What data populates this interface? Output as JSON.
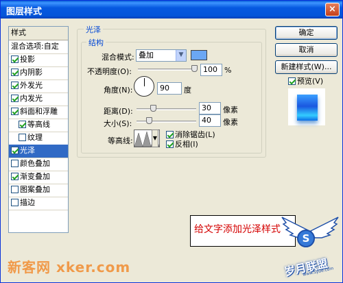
{
  "window": {
    "title": "图层样式",
    "close_glyph": "×"
  },
  "style_list": {
    "header": "样式",
    "items": [
      {
        "label": "混合选项:自定",
        "checkbox": false,
        "checked": false,
        "sub": false,
        "selected": false
      },
      {
        "label": "投影",
        "checkbox": true,
        "checked": true,
        "sub": false,
        "selected": false
      },
      {
        "label": "内阴影",
        "checkbox": true,
        "checked": true,
        "sub": false,
        "selected": false
      },
      {
        "label": "外发光",
        "checkbox": true,
        "checked": true,
        "sub": false,
        "selected": false
      },
      {
        "label": "内发光",
        "checkbox": true,
        "checked": true,
        "sub": false,
        "selected": false
      },
      {
        "label": "斜面和浮雕",
        "checkbox": true,
        "checked": true,
        "sub": false,
        "selected": false
      },
      {
        "label": "等高线",
        "checkbox": true,
        "checked": true,
        "sub": true,
        "selected": false
      },
      {
        "label": "纹理",
        "checkbox": true,
        "checked": false,
        "sub": true,
        "selected": false
      },
      {
        "label": "光泽",
        "checkbox": true,
        "checked": true,
        "sub": false,
        "selected": true
      },
      {
        "label": "颜色叠加",
        "checkbox": true,
        "checked": false,
        "sub": false,
        "selected": false
      },
      {
        "label": "渐变叠加",
        "checkbox": true,
        "checked": true,
        "sub": false,
        "selected": false
      },
      {
        "label": "图案叠加",
        "checkbox": true,
        "checked": false,
        "sub": false,
        "selected": false
      },
      {
        "label": "描边",
        "checkbox": true,
        "checked": false,
        "sub": false,
        "selected": false
      }
    ]
  },
  "satin": {
    "group_title": "光泽",
    "structure_title": "结构",
    "blend_mode_label": "混合模式:",
    "blend_mode_value": "叠加",
    "dropdown_glyph": "▼",
    "color": "#6ba7f4",
    "opacity_label": "不透明度(O):",
    "opacity_value": "100",
    "opacity_unit": "%",
    "opacity_percent": 100,
    "angle_label": "角度(N):",
    "angle_value": "90",
    "angle_unit": "度",
    "distance_label": "距离(D):",
    "distance_value": "30",
    "distance_unit": "像素",
    "distance_percent": 25,
    "size_label": "大小(S):",
    "size_value": "40",
    "size_unit": "像素",
    "size_percent": 18,
    "contour_label": "等高线:",
    "antialias_label": "消除锯齿(L)",
    "antialias_checked": true,
    "invert_label": "反相(I)",
    "invert_checked": true
  },
  "buttons": {
    "ok": "确定",
    "cancel": "取消",
    "new_style": "新建样式(W)...",
    "preview_label": "预览(V)",
    "preview_checked": true
  },
  "annotation": {
    "text": "给文字添加光泽样式",
    "bubble_glyph": "S"
  },
  "watermarks": {
    "left": "新客网 xker.com",
    "right": "岁月联盟",
    "right_url": "www.Syue.com"
  }
}
